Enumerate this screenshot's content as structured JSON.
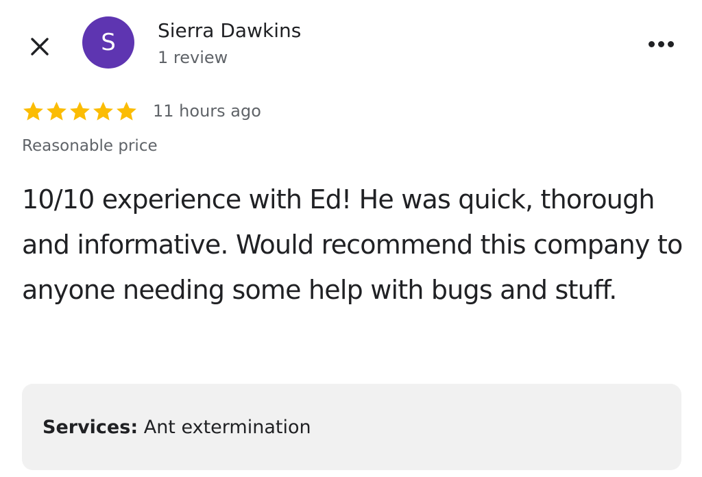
{
  "header": {
    "close_icon": "close-icon",
    "avatar_initial": "S",
    "avatar_color": "#5e35b1",
    "reviewer_name": "Sierra Dawkins",
    "review_count": "1 review",
    "more_icon": "more-horizontal-icon"
  },
  "rating": {
    "stars": 5,
    "max_stars": 5,
    "star_color": "#fbbc04",
    "time_ago": "11 hours ago"
  },
  "attribute": "Reasonable price",
  "review_text": "10/10 experience with Ed! He was quick, thorough and informative. Would recommend this company to anyone needing some help with bugs and stuff.",
  "services": {
    "label": "Services:",
    "value": "Ant extermination"
  }
}
